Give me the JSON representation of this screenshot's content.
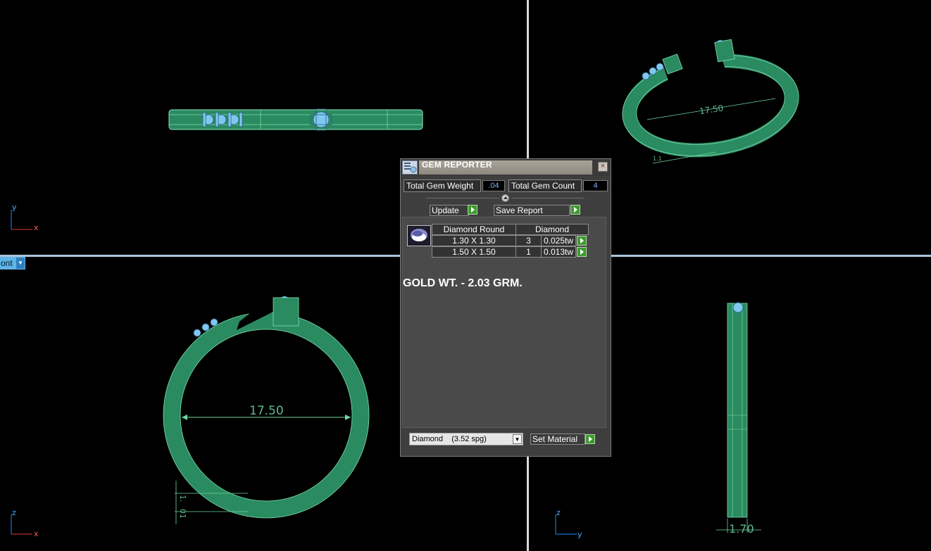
{
  "colors": {
    "ring": "#2a8a60",
    "ring_edge": "#7fe0b0",
    "gem": "#7ec8ee",
    "accent_go": "#3d9b2f"
  },
  "viewports": {
    "top": {
      "axis_up": "y",
      "axis_right": "x"
    },
    "perspective": {
      "dimension": "17.50",
      "small_dim": "1.1"
    },
    "front": {
      "tab_label": "ont",
      "axis_up": "z",
      "axis_right": "x",
      "diameter": "17.50",
      "dim_a": "1.",
      "dim_b": "01"
    },
    "right": {
      "axis_up": "z",
      "axis_right": "y",
      "width_dim": "1.70"
    }
  },
  "gem_reporter": {
    "title": "GEM REPORTER",
    "total_gem_weight_label": "Total Gem Weight",
    "total_gem_weight_value": ".04",
    "total_gem_count_label": "Total Gem Count",
    "total_gem_count_value": "4",
    "update_label": "Update",
    "save_report_label": "Save Report",
    "table": {
      "headers": [
        "Diamond Round",
        "Diamond"
      ],
      "rows": [
        {
          "size": "1.30 X 1.30",
          "count": "3",
          "weight": "0.025tw"
        },
        {
          "size": "1.50 X 1.50",
          "count": "1",
          "weight": "0.013tw"
        }
      ]
    },
    "note": "GOLD WT. - 2.03 GRM.",
    "material_selected": "Diamond    (3.52 spg)",
    "set_material_label": "Set Material"
  }
}
